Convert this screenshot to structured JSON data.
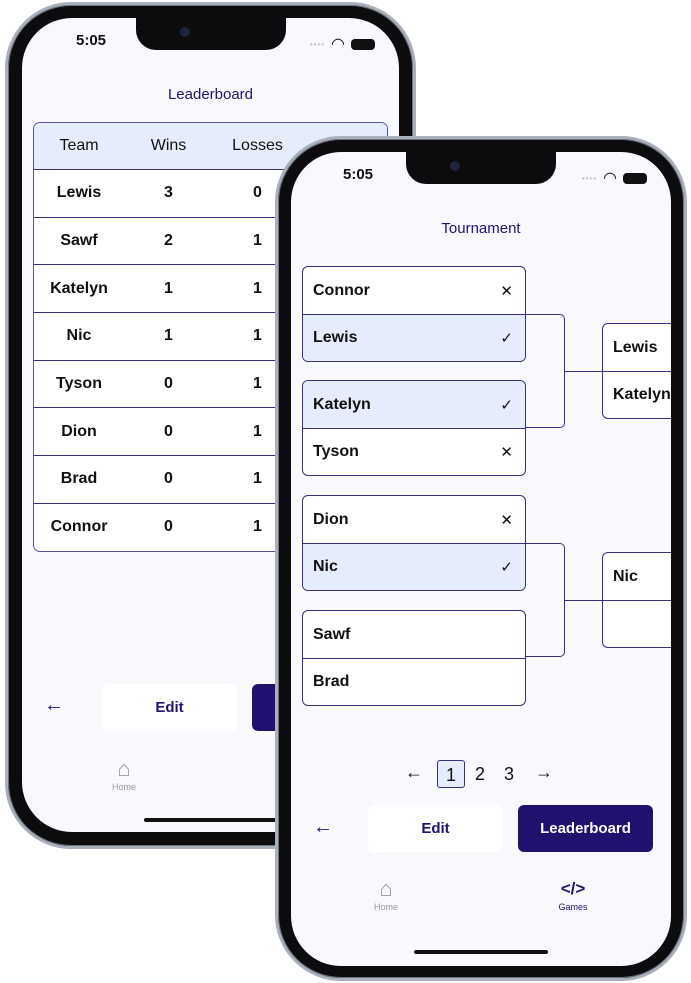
{
  "status": {
    "time": "5:05"
  },
  "leaderboard": {
    "title": "Leaderboard",
    "columns": [
      "Team",
      "Wins",
      "Losses"
    ],
    "rows": [
      [
        "Lewis",
        "3",
        "0"
      ],
      [
        "Sawf",
        "2",
        "1"
      ],
      [
        "Katelyn",
        "1",
        "1"
      ],
      [
        "Nic",
        "1",
        "1"
      ],
      [
        "Tyson",
        "0",
        "1"
      ],
      [
        "Dion",
        "0",
        "1"
      ],
      [
        "Brad",
        "0",
        "1"
      ],
      [
        "Connor",
        "0",
        "1"
      ]
    ],
    "edit_label": "Edit",
    "home_label": "Home"
  },
  "tournament": {
    "title": "Tournament",
    "round1": [
      [
        {
          "name": "Connor",
          "mark": "✕"
        },
        {
          "name": "Lewis",
          "mark": "✓",
          "winner": true
        }
      ],
      [
        {
          "name": "Katelyn",
          "mark": "✓",
          "winner": true
        },
        {
          "name": "Tyson",
          "mark": "✕"
        }
      ],
      [
        {
          "name": "Dion",
          "mark": "✕"
        },
        {
          "name": "Nic",
          "mark": "✓",
          "winner": true
        }
      ],
      [
        {
          "name": "Sawf",
          "mark": ""
        },
        {
          "name": "Brad",
          "mark": ""
        }
      ]
    ],
    "round2": [
      [
        "Lewis",
        "Katelyn"
      ],
      [
        "Nic",
        ""
      ]
    ],
    "pages": [
      "1",
      "2",
      "3"
    ],
    "current_page": "1",
    "edit_label": "Edit",
    "leaderboard_label": "Leaderboard",
    "nav": {
      "home": "Home",
      "games": "Games"
    }
  },
  "colors": {
    "accent": "#22106f",
    "highlight": "#e5ecfc"
  }
}
